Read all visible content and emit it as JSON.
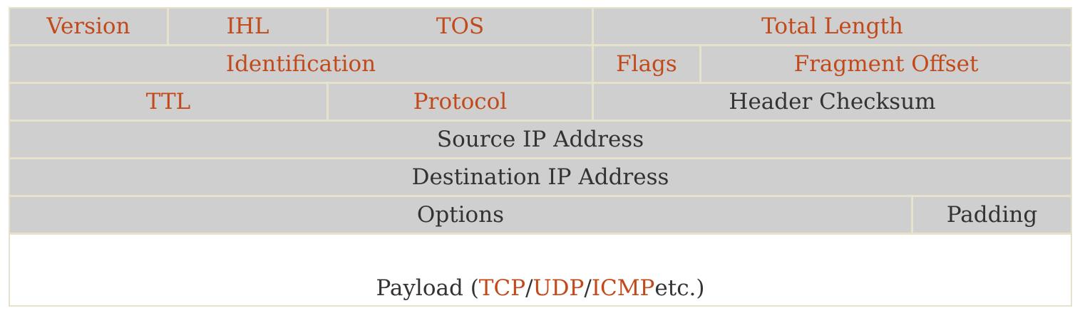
{
  "colors": {
    "field_background": "#cfcfcf",
    "border": "#e6e2cc",
    "link_text": "#c24a1a",
    "plain_text": "#333333"
  },
  "row1": {
    "version": "Version",
    "ihl": "IHL",
    "tos": "TOS",
    "total_length": "Total Length"
  },
  "row2": {
    "identification": "Identification",
    "flags": "Flags",
    "fragment_offset": "Fragment Offset"
  },
  "row3": {
    "ttl": "TTL",
    "protocol": "Protocol",
    "header_checksum": "Header Checksum"
  },
  "row4": {
    "source_ip": "Source IP Address"
  },
  "row5": {
    "destination_ip": "Destination IP Address"
  },
  "row6": {
    "options": "Options",
    "padding": "Padding"
  },
  "payload": {
    "prefix": "Payload (",
    "tcp": "TCP",
    "sep1": "/",
    "udp": "UDP",
    "sep2": "/",
    "icmp": "ICMP",
    "suffix": " etc.)"
  }
}
